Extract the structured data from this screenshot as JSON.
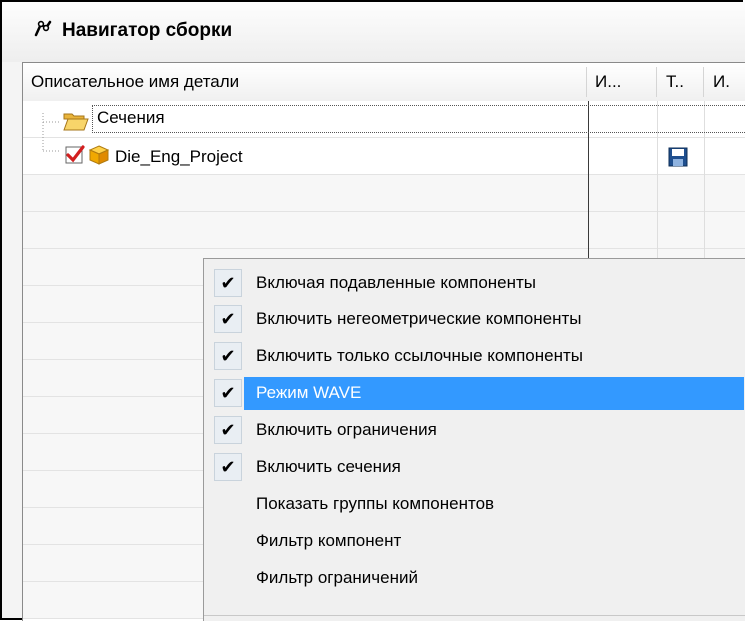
{
  "window": {
    "title": "Навигатор сборки",
    "title_icon": "assembly-navigator-icon"
  },
  "columns": [
    {
      "label": "Описательное имя детали"
    },
    {
      "label": "И..."
    },
    {
      "label": "Т.."
    },
    {
      "label": "И."
    }
  ],
  "tree": {
    "sections_label": "Сечения",
    "sections_icon": "folder-open-icon",
    "project_label": "Die_Eng_Project",
    "project_icons": [
      "checkbox-checked-icon",
      "part-cube-icon"
    ],
    "project_status_icon": "save-disk-icon"
  },
  "context_menu": {
    "items": [
      {
        "label": "Включая подавленные компоненты",
        "checked": true
      },
      {
        "label": "Включить негеометрические компоненты",
        "checked": true
      },
      {
        "label": "Включить только ссылочные компоненты",
        "checked": true
      },
      {
        "label": "Режим WAVE",
        "checked": true,
        "highlighted": true
      },
      {
        "label": "Включить ограничения",
        "checked": true
      },
      {
        "label": "Включить сечения",
        "checked": true
      },
      {
        "label": "Показать группы компонентов",
        "checked": false
      },
      {
        "label": "Фильтр компонент",
        "checked": false
      },
      {
        "label": "Фильтр ограничений",
        "checked": false
      }
    ],
    "check_glyph": "✔",
    "highlight_color": "#3399ff"
  }
}
